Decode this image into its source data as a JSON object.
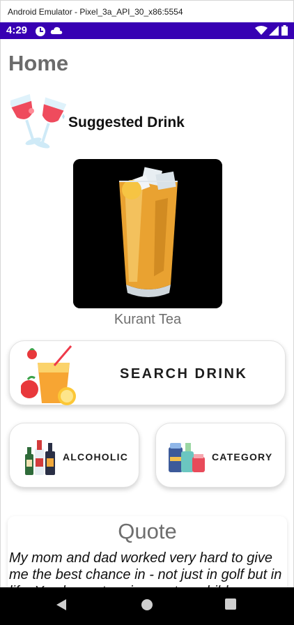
{
  "window": {
    "title": "Android Emulator - Pixel_3a_API_30_x86:5554"
  },
  "status_bar": {
    "time": "4:29"
  },
  "home": {
    "title": "Home",
    "suggested_title": "Suggested Drink",
    "drink_name": "Kurant Tea"
  },
  "buttons": {
    "search": "SEARCH DRINK",
    "alcoholic": "ALCOHOLIC",
    "category": "CATEGORY"
  },
  "quote": {
    "title": "Quote",
    "text": "My mom and dad worked very hard to give me the best chance in - not just in golf but in life. You know, to raise my two children..."
  }
}
